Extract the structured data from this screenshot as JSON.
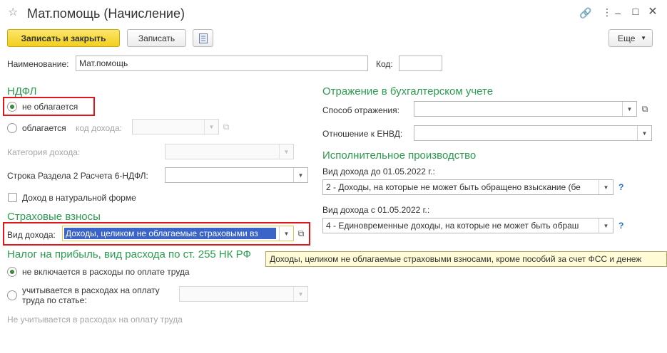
{
  "window": {
    "title": "Мат.помощь (Начисление)"
  },
  "toolbar": {
    "save_close_label": "Записать и закрыть",
    "save_label": "Записать",
    "more_label": "Еще"
  },
  "form": {
    "name_label": "Наименование:",
    "name_value": "Мат.помощь",
    "code_label": "Код:",
    "code_value": ""
  },
  "ndfl": {
    "title": "НДФЛ",
    "not_taxed_label": "не облагается",
    "taxed_label": "облагается",
    "income_code_label": "код дохода:",
    "income_category_label": "Категория дохода:",
    "section2_label": "Строка Раздела 2 Расчета 6-НДФЛ:",
    "in_kind_label": "Доход в натуральной форме"
  },
  "insurance": {
    "title": "Страховые взносы",
    "income_type_label": "Вид дохода:",
    "income_type_value": "Доходы, целиком не облагаемые страховыми вз",
    "tooltip": "Доходы, целиком не облагаемые страховыми взносами, кроме пособий за счет ФСС и денеж"
  },
  "profit_tax": {
    "title": "Налог на прибыль, вид расхода по ст. 255 НК РФ",
    "option_excluded": "не включается в расходы по оплате труда",
    "option_included_line1": "учитывается в расходах на оплату",
    "option_included_line2": "труда по статье:",
    "note": "Не учитывается в расходах на оплату труда"
  },
  "accounting": {
    "title": "Отражение в бухгалтерском учете",
    "method_label": "Способ отражения:",
    "envd_label": "Отношение к ЕНВД:"
  },
  "enforcement": {
    "title": "Исполнительное производство",
    "before_label": "Вид дохода до 01.05.2022 г.:",
    "before_value": "2 - Доходы, на которые не может быть обращено взыскание (бе",
    "after_label": "Вид дохода с 01.05.2022 г.:",
    "after_value": "4 - Единовременные доходы, на которые не может быть обраш",
    "help": "?"
  }
}
